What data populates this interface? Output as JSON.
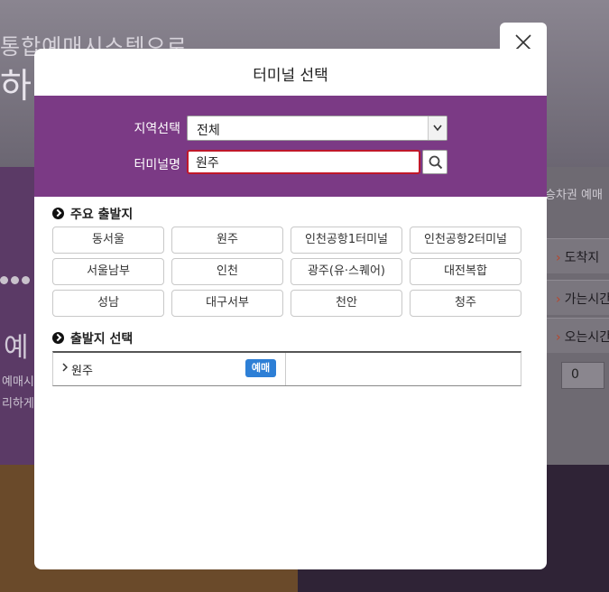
{
  "background": {
    "slogan_line1": "통합예매시스템으로",
    "slogan_line2": "하",
    "right_tab_text": "승차권 예매",
    "rows": [
      {
        "label": "도착지"
      },
      {
        "label": "가는시간"
      },
      {
        "label": "오는시간"
      }
    ],
    "count_select_value": "0",
    "left_big_word": "예",
    "left_small1": "예매시",
    "left_small2": "리하게"
  },
  "modal": {
    "title": "터미널 선택",
    "close_label": "close",
    "region_label": "지역선택",
    "region_selected": "전체",
    "terminal_label": "터미널명",
    "terminal_input_value": "원주",
    "major_title": "주요 출발지",
    "major_terminals": [
      "동서울",
      "원주",
      "인천공항1터미널",
      "인천공항2터미널",
      "서울남부",
      "인천",
      "광주(유·스퀘어)",
      "대전복합",
      "성남",
      "대구서부",
      "천안",
      "청주"
    ],
    "select_title": "출발지 선택",
    "results": [
      {
        "name": "원주",
        "badge": "예매"
      }
    ]
  },
  "colors": {
    "accent_purple": "#7b3a85",
    "input_border_red": "#c0182a",
    "badge_blue": "#2d7fd6"
  },
  "icons": {
    "close": "close-icon",
    "search": "search-icon",
    "caret": "chevron-down-icon",
    "bullet": "circle-chevron-right-icon",
    "result_arrow": "chevron-right-icon"
  }
}
